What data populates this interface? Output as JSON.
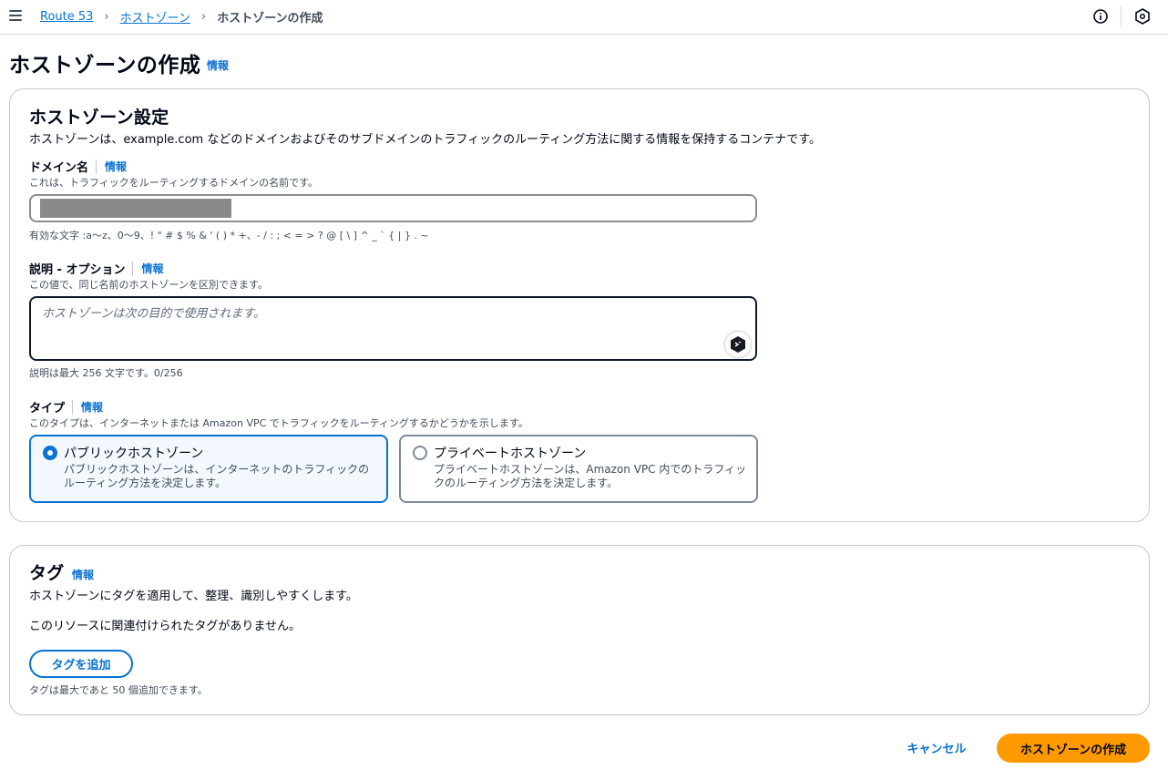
{
  "breadcrumb": {
    "items": [
      "Route 53",
      "ホストゾーン"
    ],
    "current": "ホストゾーンの作成"
  },
  "icons": {
    "menu": "hamburger-menu-icon",
    "info": "info-circle-icon",
    "assistant": "hexagon-assistant-icon"
  },
  "page": {
    "title": "ホストゾーンの作成",
    "info": "情報"
  },
  "settings": {
    "title": "ホストゾーン設定",
    "description": "ホストゾーンは、example.com などのドメインおよびそのサブドメインのトラフィックのルーティング方法に関する情報を保持するコンテナです。",
    "domain": {
      "label": "ドメイン名",
      "info": "情報",
      "description": "これは、トラフィックをルーティングするドメインの名前です。",
      "constraint": "有効な文字 :a〜z、0〜9、! \" # $ % & ' ( ) * +、- / : ; < = > ? @ [ \\ ] ^ _ ` { | } . ~"
    },
    "comment": {
      "label": "説明 - オプション",
      "info": "情報",
      "description": "この値で、同じ名前のホストゾーンを区別できます。",
      "placeholder": "ホストゾーンは次の目的で使用されます。",
      "constraint": "説明は最大 256 文字です。0/256"
    },
    "type": {
      "label": "タイプ",
      "info": "情報",
      "description": "このタイプは、インターネットまたは Amazon VPC でトラフィックをルーティングするかどうかを示します。",
      "options": [
        {
          "title": "パブリックホストゾーン",
          "description": "パブリックホストゾーンは、インターネットのトラフィックのルーティング方法を決定します。",
          "selected": true
        },
        {
          "title": "プライベートホストゾーン",
          "description": "プライベートホストゾーンは、Amazon VPC 内でのトラフィックのルーティング方法を決定します。",
          "selected": false
        }
      ]
    }
  },
  "tags": {
    "title": "タグ",
    "info": "情報",
    "description": "ホストゾーンにタグを適用して、整理、識別しやすくします。",
    "empty": "このリソースに関連付けられたタグがありません。",
    "add_button": "タグを追加",
    "limit": "タグは最大であと 50 個追加できます。"
  },
  "actions": {
    "cancel": "キャンセル",
    "create": "ホストゾーンの作成"
  },
  "colors": {
    "link": "#0972d3",
    "primary_button": "#ff9900",
    "selected_tile_bg": "#f2f8fd"
  }
}
